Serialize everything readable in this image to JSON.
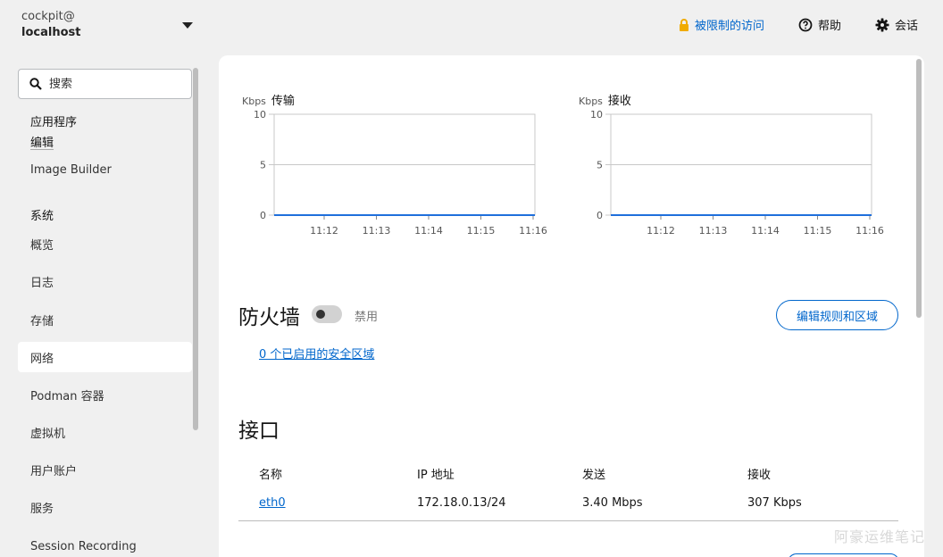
{
  "host": {
    "user": "cockpit@",
    "name": "localhost"
  },
  "topnav": {
    "limited_access": "被限制的访问",
    "help": "帮助",
    "session": "会话"
  },
  "sidebar": {
    "search_placeholder": "搜索",
    "apps_group": "应用程序",
    "apps_edit": "编辑",
    "image_builder": "Image Builder",
    "system_group": "系统",
    "items": [
      "概览",
      "日志",
      "存储",
      "网络",
      "Podman 容器",
      "虚拟机",
      "用户账户",
      "服务",
      "Session Recording"
    ],
    "active": "网络"
  },
  "charts": {
    "transmit": {
      "unit": "Kbps",
      "label": "传输"
    },
    "receive": {
      "unit": "Kbps",
      "label": "接收"
    },
    "y_ticks": [
      "10",
      "5",
      "0"
    ],
    "x_ticks": [
      "11:12",
      "11:13",
      "11:14",
      "11:15",
      "11:16"
    ],
    "line_color": "#1f6fdc"
  },
  "chart_data": [
    {
      "type": "line",
      "title": "传输",
      "ylabel": "Kbps",
      "categories": [
        "11:12",
        "11:13",
        "11:14",
        "11:15",
        "11:16"
      ],
      "values": [
        0,
        0,
        0,
        0,
        0
      ],
      "ylim": [
        0,
        10
      ],
      "grid": true
    },
    {
      "type": "line",
      "title": "接收",
      "ylabel": "Kbps",
      "categories": [
        "11:12",
        "11:13",
        "11:14",
        "11:15",
        "11:16"
      ],
      "values": [
        0,
        0,
        0,
        0,
        0
      ],
      "ylim": [
        0,
        10
      ],
      "grid": true
    }
  ],
  "firewall": {
    "title": "防火墙",
    "toggle_label": "禁用",
    "edit_button": "编辑规则和区域",
    "zones_link": "0 个已启用的安全区域"
  },
  "interfaces": {
    "title": "接口",
    "columns": [
      "名称",
      "IP 地址",
      "发送",
      "接收"
    ],
    "rows": [
      {
        "name": "eth0",
        "ip": "172.18.0.13/24",
        "send": "3.40 Mbps",
        "recv": "307 Kbps"
      }
    ]
  },
  "watermark": "阿豪运维笔记",
  "colors": {
    "accent": "#0066cc",
    "lock": "#f0ab00"
  }
}
